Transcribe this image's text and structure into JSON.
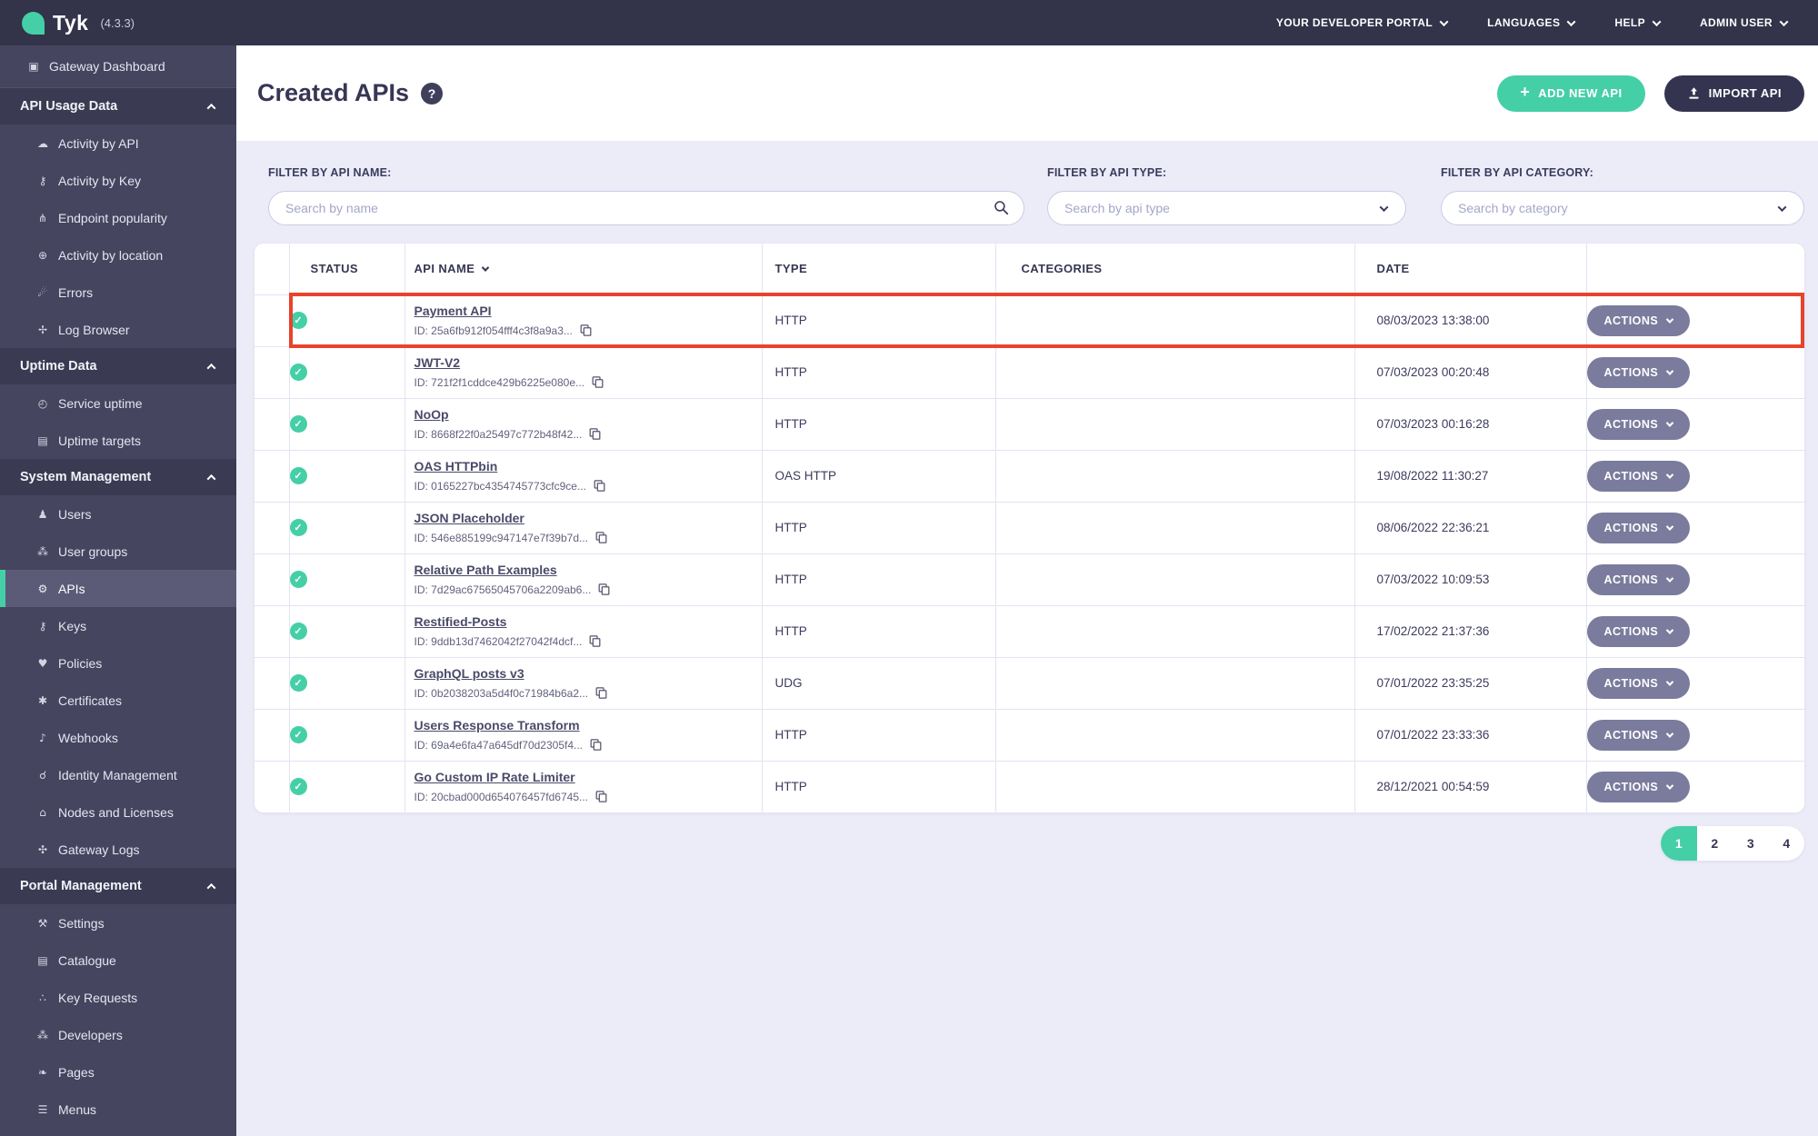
{
  "colors": {
    "accent_teal": "#45CFA7",
    "topbar_bg": "#33334A",
    "sidebar_bg": "#45455F",
    "section_header_bg": "#3A3A52",
    "active_item_bg": "#5B5B77",
    "main_bg": "#EBECF8",
    "highlight_red": "#E8432C",
    "actions_button": "#7B7B9D",
    "import_button": "#343450"
  },
  "topbar": {
    "logo_text": "Tyk",
    "version": "(4.3.3)",
    "menus": [
      "YOUR DEVELOPER PORTAL",
      "LANGUAGES",
      "HELP",
      "ADMIN USER"
    ]
  },
  "sidebar": {
    "standalone": {
      "label": "Gateway Dashboard",
      "icon": "▣",
      "icon_name": "monitor-icon"
    },
    "sections": [
      {
        "label": "API Usage Data",
        "items": [
          {
            "label": "Activity by API",
            "icon": "☁",
            "icon_name": "activity-api-icon"
          },
          {
            "label": "Activity by Key",
            "icon": "⚷",
            "icon_name": "key-icon"
          },
          {
            "label": "Endpoint popularity",
            "icon": "⋔",
            "icon_name": "branch-icon"
          },
          {
            "label": "Activity by location",
            "icon": "⊕",
            "icon_name": "globe-icon"
          },
          {
            "label": "Errors",
            "icon": "☄",
            "icon_name": "error-icon"
          },
          {
            "label": "Log Browser",
            "icon": "✢",
            "icon_name": "bug-icon"
          }
        ]
      },
      {
        "label": "Uptime Data",
        "items": [
          {
            "label": "Service uptime",
            "icon": "◴",
            "icon_name": "uptime-clock-icon"
          },
          {
            "label": "Uptime targets",
            "icon": "▤",
            "icon_name": "targets-list-icon"
          }
        ]
      },
      {
        "label": "System Management",
        "items": [
          {
            "label": "Users",
            "icon": "♟",
            "icon_name": "user-icon"
          },
          {
            "label": "User groups",
            "icon": "⁂",
            "icon_name": "user-group-icon"
          },
          {
            "label": "APIs",
            "icon": "⚙",
            "icon_name": "gears-icon",
            "active": true
          },
          {
            "label": "Keys",
            "icon": "⚷",
            "icon_name": "keys-icon"
          },
          {
            "label": "Policies",
            "icon": "♥",
            "icon_name": "policies-icon"
          },
          {
            "label": "Certificates",
            "icon": "✱",
            "icon_name": "certificate-icon"
          },
          {
            "label": "Webhooks",
            "icon": "♪",
            "icon_name": "bell-icon"
          },
          {
            "label": "Identity Management",
            "icon": "☌",
            "icon_name": "identity-icon"
          },
          {
            "label": "Nodes and Licenses",
            "icon": "⌂",
            "icon_name": "building-icon"
          },
          {
            "label": "Gateway Logs",
            "icon": "✣",
            "icon_name": "gateway-logs-bug-icon"
          }
        ]
      },
      {
        "label": "Portal Management",
        "items": [
          {
            "label": "Settings",
            "icon": "⚒",
            "icon_name": "wrench-icon"
          },
          {
            "label": "Catalogue",
            "icon": "▤",
            "icon_name": "catalogue-icon"
          },
          {
            "label": "Key Requests",
            "icon": "∴",
            "icon_name": "paw-icon"
          },
          {
            "label": "Developers",
            "icon": "⁂",
            "icon_name": "developers-icon"
          },
          {
            "label": "Pages",
            "icon": "❧",
            "icon_name": "leaf-icon"
          },
          {
            "label": "Menus",
            "icon": "☰",
            "icon_name": "menu-icon"
          }
        ]
      }
    ]
  },
  "header": {
    "title": "Created APIs",
    "help_icon": "?",
    "add_button": "ADD NEW API",
    "add_plus": "+",
    "import_button": "IMPORT API"
  },
  "filters": {
    "name": {
      "label": "FILTER BY API NAME:",
      "placeholder": "Search by name"
    },
    "type": {
      "label": "FILTER BY API TYPE:",
      "placeholder": "Search by api type"
    },
    "category": {
      "label": "FILTER BY API CATEGORY:",
      "placeholder": "Search by category"
    }
  },
  "table": {
    "columns": [
      "STATUS",
      "API NAME",
      "TYPE",
      "CATEGORIES",
      "DATE"
    ],
    "actions_label": "ACTIONS",
    "status_icon": "✓",
    "rows": [
      {
        "status": "active",
        "name": "Payment API",
        "id": "ID: 25a6fb912f054fff4c3f8a9a3...",
        "type": "HTTP",
        "categories": "",
        "date": "08/03/2023 13:38:00",
        "highlighted": true
      },
      {
        "status": "active",
        "name": "JWT-V2",
        "id": "ID: 721f2f1cddce429b6225e080e...",
        "type": "HTTP",
        "categories": "",
        "date": "07/03/2023 00:20:48"
      },
      {
        "status": "active",
        "name": "NoOp",
        "id": "ID: 8668f22f0a25497c772b48f42...",
        "type": "HTTP",
        "categories": "",
        "date": "07/03/2023 00:16:28"
      },
      {
        "status": "active",
        "name": "OAS HTTPbin",
        "id": "ID: 0165227bc4354745773cfc9ce...",
        "type": "OAS HTTP",
        "categories": "",
        "date": "19/08/2022 11:30:27"
      },
      {
        "status": "active",
        "name": "JSON Placeholder",
        "id": "ID: 546e885199c947147e7f39b7d...",
        "type": "HTTP",
        "categories": "",
        "date": "08/06/2022 22:36:21"
      },
      {
        "status": "active",
        "name": "Relative Path Examples",
        "id": "ID: 7d29ac67565045706a2209ab6...",
        "type": "HTTP",
        "categories": "",
        "date": "07/03/2022 10:09:53"
      },
      {
        "status": "active",
        "name": "Restified-Posts",
        "id": "ID: 9ddb13d7462042f27042f4dcf...",
        "type": "HTTP",
        "categories": "",
        "date": "17/02/2022 21:37:36"
      },
      {
        "status": "active",
        "name": "GraphQL posts v3",
        "id": "ID: 0b2038203a5d4f0c71984b6a2...",
        "type": "UDG",
        "categories": "",
        "date": "07/01/2022 23:35:25"
      },
      {
        "status": "active",
        "name": "Users Response Transform",
        "id": "ID: 69a4e6fa47a645df70d2305f4...",
        "type": "HTTP",
        "categories": "",
        "date": "07/01/2022 23:33:36"
      },
      {
        "status": "active",
        "name": "Go Custom IP Rate Limiter",
        "id": "ID: 20cbad000d654076457fd6745...",
        "type": "HTTP",
        "categories": "",
        "date": "28/12/2021 00:54:59"
      }
    ]
  },
  "pagination": {
    "pages": [
      "1",
      "2",
      "3",
      "4"
    ],
    "active": "1"
  }
}
